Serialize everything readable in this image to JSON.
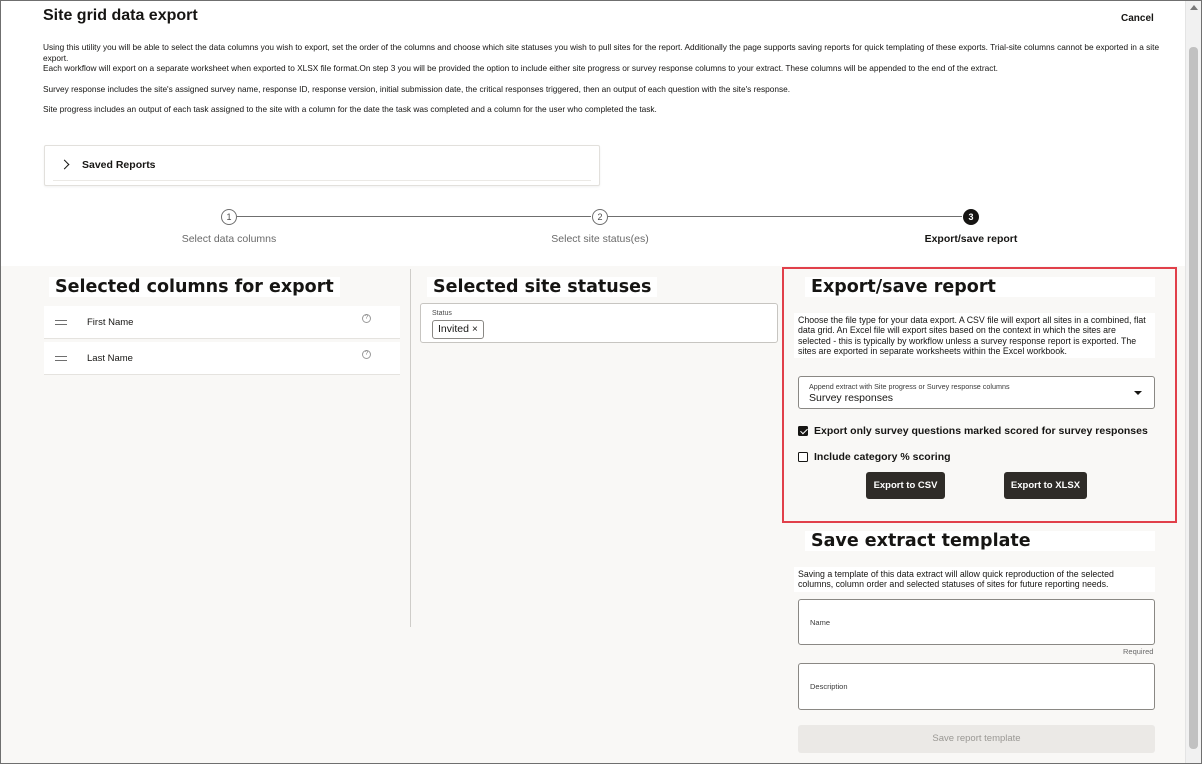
{
  "header": {
    "title": "Site grid data export",
    "cancel_label": "Cancel"
  },
  "intro": {
    "p1_line1": "Using this utility you will be able to select the data columns you wish to export, set the order of the columns and choose which site statuses you wish to pull sites for the report. Additionally the page supports saving reports for quick templating of these exports. Trial-site columns cannot be exported in a site export.",
    "p1_line2": "Each workflow will export on a separate worksheet when exported to XLSX file format.On step 3 you will be provided the option to include either site progress or survey response columns to your extract. These columns will be appended to the end of the extract.",
    "p2": "Survey response includes the site's assigned survey name, response ID, response version, initial submission date, the critical responses triggered, then an output of each question with the site's response.",
    "p3": "Site progress includes an output of each task assigned to the site with a column for the date the task was completed and a column for the user who completed the task."
  },
  "saved_reports": {
    "label": "Saved Reports"
  },
  "stepper": {
    "steps": [
      {
        "number": "1",
        "label": "Select data columns",
        "active": false
      },
      {
        "number": "2",
        "label": "Select site status(es)",
        "active": false
      },
      {
        "number": "3",
        "label": "Export/save report",
        "active": true
      }
    ]
  },
  "columns_panel": {
    "title": "Selected columns for export",
    "items": [
      {
        "label": "First Name",
        "help_icon": "question-circle-icon"
      },
      {
        "label": "Last Name",
        "help_icon": "question-circle-icon"
      }
    ]
  },
  "status_panel": {
    "title": "Selected site statuses",
    "field_label": "Status",
    "chips": [
      "Invited"
    ],
    "chip_remove_glyph": "×"
  },
  "export_panel": {
    "title": "Export/save report",
    "description": "Choose the file type for your data export. A CSV file will export all sites in a combined, flat data grid. An Excel file will export sites based on the context in which the sites are selected - this is typically by workflow unless a survey response report is exported. The sites are exported in separate worksheets within the Excel workbook.",
    "append_select": {
      "label": "Append extract with Site progress or Survey response columns",
      "value": "Survey responses"
    },
    "checkboxes": [
      {
        "label": "Export only survey questions marked scored for survey responses",
        "checked": true
      },
      {
        "label": "Include category % scoring",
        "checked": false
      }
    ],
    "export_csv_label": "Export to CSV",
    "export_xlsx_label": "Export to XLSX"
  },
  "template_panel": {
    "title": "Save extract template",
    "description": "Saving a template of this data extract will allow quick reproduction of the selected columns, column order and selected statuses of sites for future reporting needs.",
    "name_label": "Name",
    "name_value": "",
    "required_label": "Required",
    "description_label": "Description",
    "description_value": "",
    "save_label": "Save report template"
  },
  "colors": {
    "accent_highlight": "#e1404a",
    "primary_button": "#2f2c28",
    "text": "#161513",
    "panel_bg": "#f9f8f6"
  }
}
